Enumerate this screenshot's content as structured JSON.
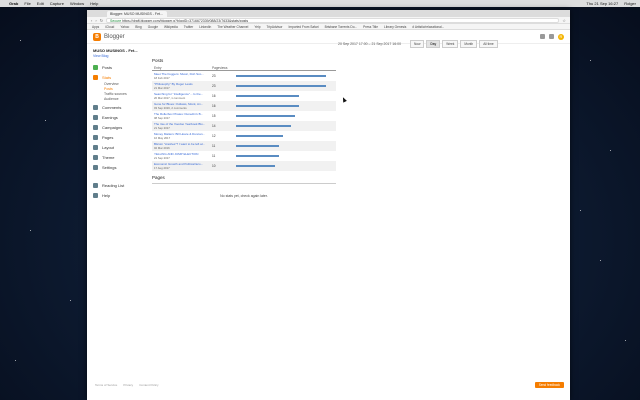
{
  "menubar": {
    "app": "Grab",
    "items": [
      "File",
      "Edit",
      "Capture",
      "Window",
      "Help"
    ],
    "clock": "Thu 21 Sep 16:27",
    "user": "Rolger"
  },
  "browser": {
    "tab_title": "Blogger: MUSO MUSINGS - Fet...",
    "url_secure_label": "Secure",
    "url": "https://draft.blogger.com/blogger.g?blogID=3716672339/088/23/7633&stats/posts",
    "bookmarks": [
      "Apps",
      "iCloud",
      "Yahoo",
      "Bing",
      "Google",
      "Wikipedia",
      "Twitter",
      "LinkedIn",
      "The Weather Channel",
      "Yelp",
      "TripAdvisor",
      "Imported From Safari",
      "Brisbane Torrents Do...",
      "Press Title",
      "Library Genesis",
      "# Artistic/relaxational..."
    ]
  },
  "header": {
    "logo_letter": "B",
    "title": "Blogger",
    "avatar_letter": "R"
  },
  "sidebar": {
    "blog_name": "MUSO MUSINGS - Fet...",
    "view_blog": "View Blog",
    "items": [
      {
        "label": "Posts",
        "color": "#4caf50",
        "active": false
      },
      {
        "label": "Stats",
        "color": "#f57d00",
        "active": true
      }
    ],
    "sub_items": [
      {
        "label": "Overview",
        "active": false
      },
      {
        "label": "Posts",
        "active": true
      },
      {
        "label": "Traffic sources",
        "active": false
      },
      {
        "label": "Audience",
        "active": false
      }
    ],
    "items_after": [
      {
        "label": "Comments",
        "color": "#607d8b"
      },
      {
        "label": "Earnings",
        "color": "#607d8b"
      },
      {
        "label": "Campaigns",
        "color": "#607d8b"
      },
      {
        "label": "Pages",
        "color": "#607d8b"
      },
      {
        "label": "Layout",
        "color": "#607d8b"
      },
      {
        "label": "Theme",
        "color": "#607d8b"
      },
      {
        "label": "Settings",
        "color": "#607d8b"
      }
    ],
    "bottom_items": [
      {
        "label": "Reading List",
        "color": "#607d8b"
      },
      {
        "label": "Help",
        "color": "#607d8b"
      }
    ]
  },
  "date_range": "20 Sep 2017 17:00 – 21 Sep 2017 16:00",
  "range_buttons": [
    {
      "label": "Now",
      "selected": false
    },
    {
      "label": "Day",
      "selected": true
    },
    {
      "label": "Week",
      "selected": false
    },
    {
      "label": "Month",
      "selected": false
    },
    {
      "label": "All time",
      "selected": false
    }
  ],
  "posts_section": {
    "title": "Posts",
    "col_entry": "Entry",
    "col_pageviews": "Pageviews",
    "rows": [
      {
        "title": "Meet The Fuggers: Music, Fish Sco...",
        "date": "18 Feb 2017",
        "pageviews": 23
      },
      {
        "title": "\"Philosophy\" By Roger Lewis",
        "date": "21 Mar 2017",
        "pageviews": 23
      },
      {
        "title": "Searching for \"Intelligence\"... Is the...",
        "date": "20 Mar 2017, 1 comment",
        "pageviews": 16
      },
      {
        "title": "Gone for Blues: Outlaws, Monk, An...",
        "date": "03 Sep 2016, 2 comments",
        "pageviews": 16
      },
      {
        "title": "The Rollerbox Pirates: Dunedin's B...",
        "date": "08 Sep 2017",
        "pageviews": 15
      },
      {
        "title": "The rise of the Voodoo Yearbook Blu...",
        "date": "21 Sep 2017",
        "pageviews": 14
      },
      {
        "title": "Money Matters: Bill Hoare & Duncan...",
        "date": "16 May 2017",
        "pageviews": 12
      },
      {
        "title": "Bitcoin \"crashes\"? I want to be left al...",
        "date": "02 Mar 2016",
        "pageviews": 11
      },
      {
        "title": "YELLING AND JUMP ELECTION",
        "date": "21 Sep 2017",
        "pageviews": 11
      },
      {
        "title": "Economic Growth and Political Eco...",
        "date": "17 Aug 2017",
        "pageviews": 10
      }
    ],
    "max_pageviews": 23
  },
  "pages_section": {
    "title": "Pages",
    "empty_message": "No stats yet, check again later."
  },
  "footer": {
    "links": [
      "Terms of Service",
      "Privacy",
      "Content Policy"
    ],
    "feedback": "Send feedback"
  }
}
